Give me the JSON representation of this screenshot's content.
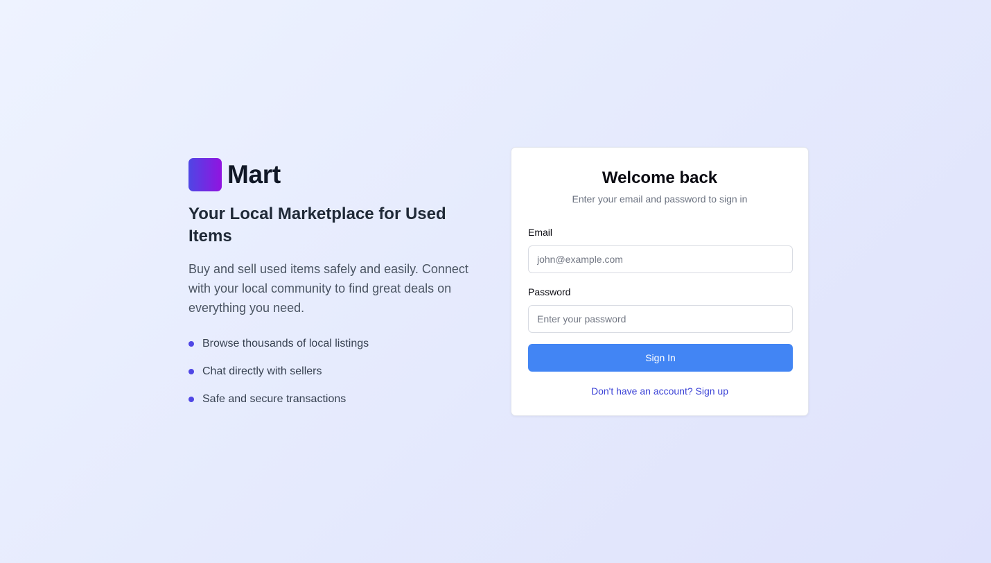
{
  "brand": {
    "name": "Mart",
    "logo_gradient": [
      "#4f46e5",
      "#9113e0"
    ]
  },
  "hero": {
    "tagline": "Your Local Marketplace for Used Items",
    "description": "Buy and sell used items safely and easily. Connect with your local community to find great deals on everything you need.",
    "features": [
      "Browse thousands of local listings",
      "Chat directly with sellers",
      "Safe and secure transactions"
    ]
  },
  "login": {
    "title": "Welcome back",
    "subtitle": "Enter your email and password to sign in",
    "email_label": "Email",
    "email_value": "",
    "email_placeholder": "john@example.com",
    "password_label": "Password",
    "password_value": "",
    "password_placeholder": "Enter your password",
    "submit_label": "Sign In",
    "signup_link": "Don't have an account? Sign up"
  },
  "colors": {
    "accent": "#4f46e5",
    "button": "#4285f4",
    "link": "#3b42d6"
  }
}
